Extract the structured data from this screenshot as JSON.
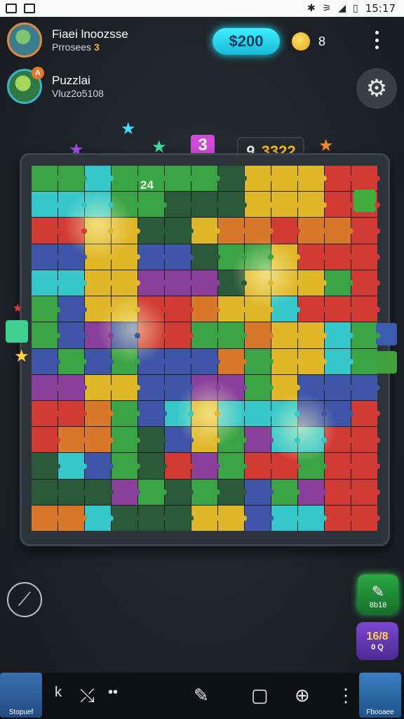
{
  "status_bar": {
    "left_icons": [
      "image-icon",
      "save-icon"
    ],
    "right_symbols": [
      "✱",
      "⚞",
      "◢",
      "▯"
    ],
    "time": "15:17"
  },
  "players": [
    {
      "name": "Fiaei lnoozsse",
      "sub": "Prrosees",
      "badge": "",
      "dot": "3"
    },
    {
      "name": "Puzzlai",
      "sub": "Vluz2o5108",
      "badge": "A",
      "dot": ""
    }
  ],
  "currency": {
    "cash": "$200",
    "coins": "8"
  },
  "game": {
    "score_prefix": "9",
    "score": "3322",
    "moves": "24",
    "puzzle_logo": "3"
  },
  "powerups": {
    "p1_label": "8b18",
    "p2_value": "16/8",
    "p2_sub": "0 Q"
  },
  "bottom_nav": {
    "left_label": "Stopuef",
    "right_label": "Fbooaee",
    "icons": [
      "k",
      "⤯",
      "•• ",
      "✎",
      "▢",
      "⊕",
      "⋮"
    ]
  },
  "colors": {
    "accent_cyan": "#3ef0ff",
    "gold": "#f5b629",
    "board_bg": "#1b1f24"
  },
  "board": {
    "rows": 14,
    "cols": 13,
    "tiles": [
      "GGCGGGGDYYYRR",
      "CCCGGDDDYYYRR",
      "RRYYDDYOOROOR",
      "BBYYBBDGGYRRR",
      "CCYYPPPDYYYGR",
      "GBYYRROYYCRRR",
      "GBPBRRGGOYYCG",
      "BGBGBBBOGYYCG",
      "PPYYBBPPGYBBB",
      "RROGBCYCCCBBR",
      "ROOGDBYGPCCRR",
      "DCBGDRPGRRGRR",
      "DDDPGDGDBGPRR",
      "OOCDDDYYBCCRR"
    ]
  }
}
